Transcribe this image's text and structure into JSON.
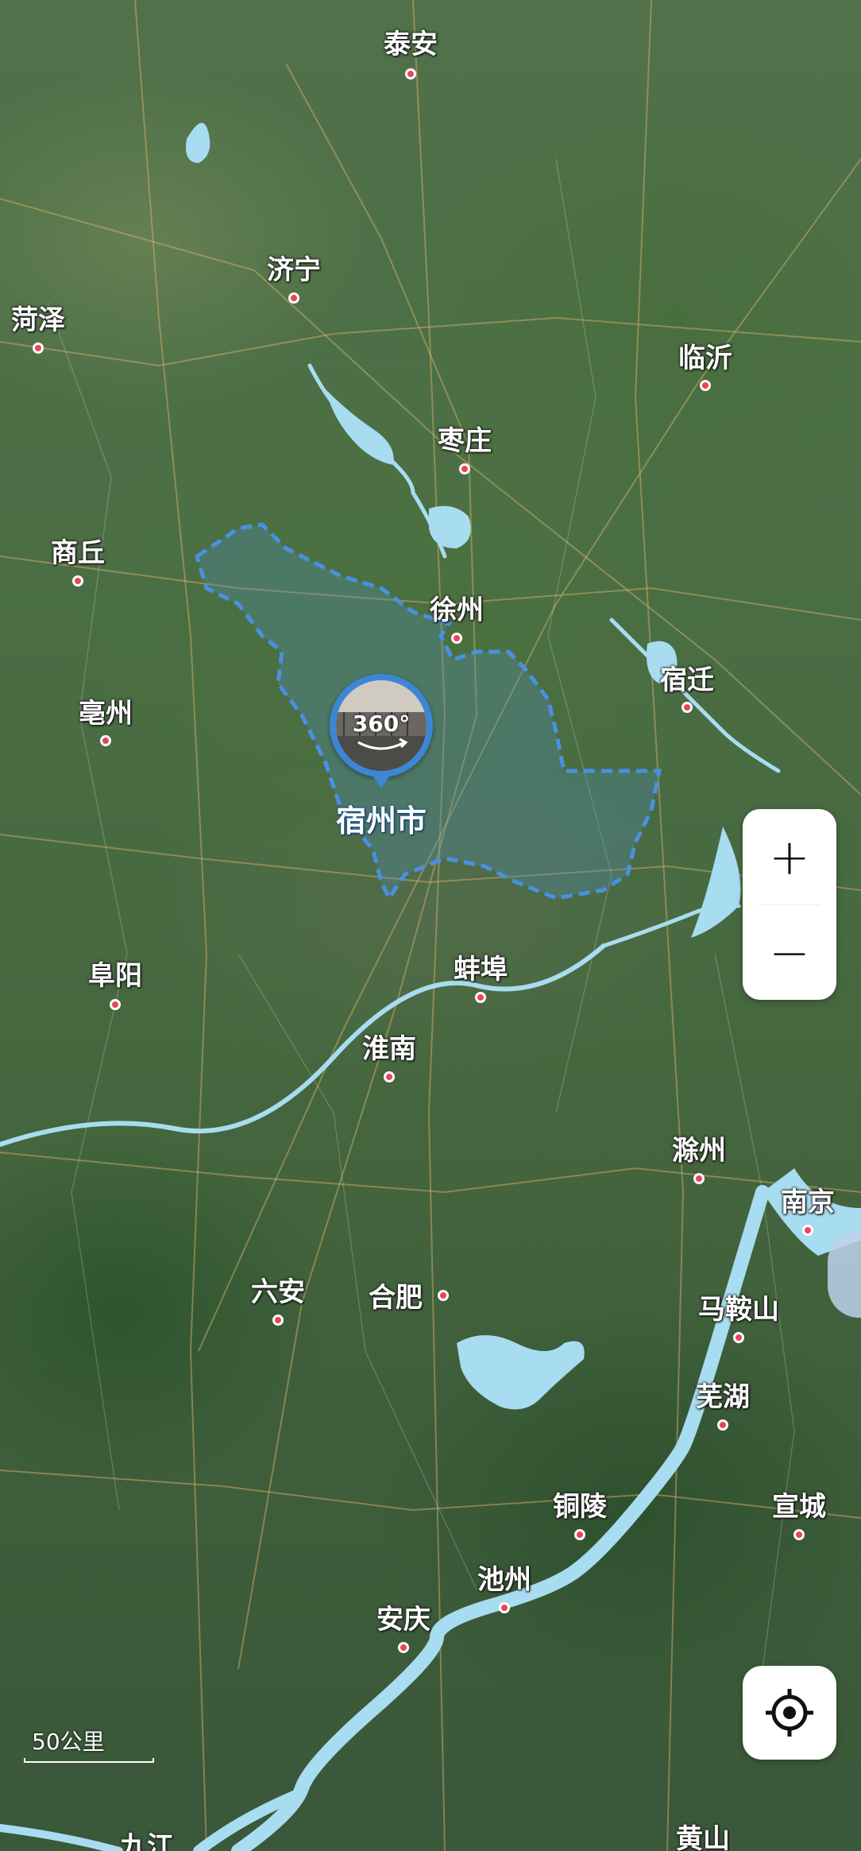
{
  "map": {
    "scale_label": "50公里",
    "selected_city": "宿州市",
    "panorama_badge": "360°",
    "zoom_in_label": "+",
    "zoom_out_label": "−",
    "cities": [
      {
        "name": "泰安"
      },
      {
        "name": "济宁"
      },
      {
        "name": "菏泽"
      },
      {
        "name": "临沂"
      },
      {
        "name": "枣庄"
      },
      {
        "name": "商丘"
      },
      {
        "name": "徐州"
      },
      {
        "name": "宿迁"
      },
      {
        "name": "亳州"
      },
      {
        "name": "阜阳"
      },
      {
        "name": "蚌埠"
      },
      {
        "name": "淮南"
      },
      {
        "name": "滁州"
      },
      {
        "name": "南京"
      },
      {
        "name": "六安"
      },
      {
        "name": "合肥"
      },
      {
        "name": "马鞍山"
      },
      {
        "name": "芜湖"
      },
      {
        "name": "铜陵"
      },
      {
        "name": "宣城"
      },
      {
        "name": "池州"
      },
      {
        "name": "安庆"
      },
      {
        "name": "九江"
      },
      {
        "name": "黄山"
      }
    ],
    "colors": {
      "boundary": "#4a90e2",
      "water": "#a8dcf0",
      "city_dot": "#e8455a",
      "pin": "#3d86d6"
    }
  }
}
